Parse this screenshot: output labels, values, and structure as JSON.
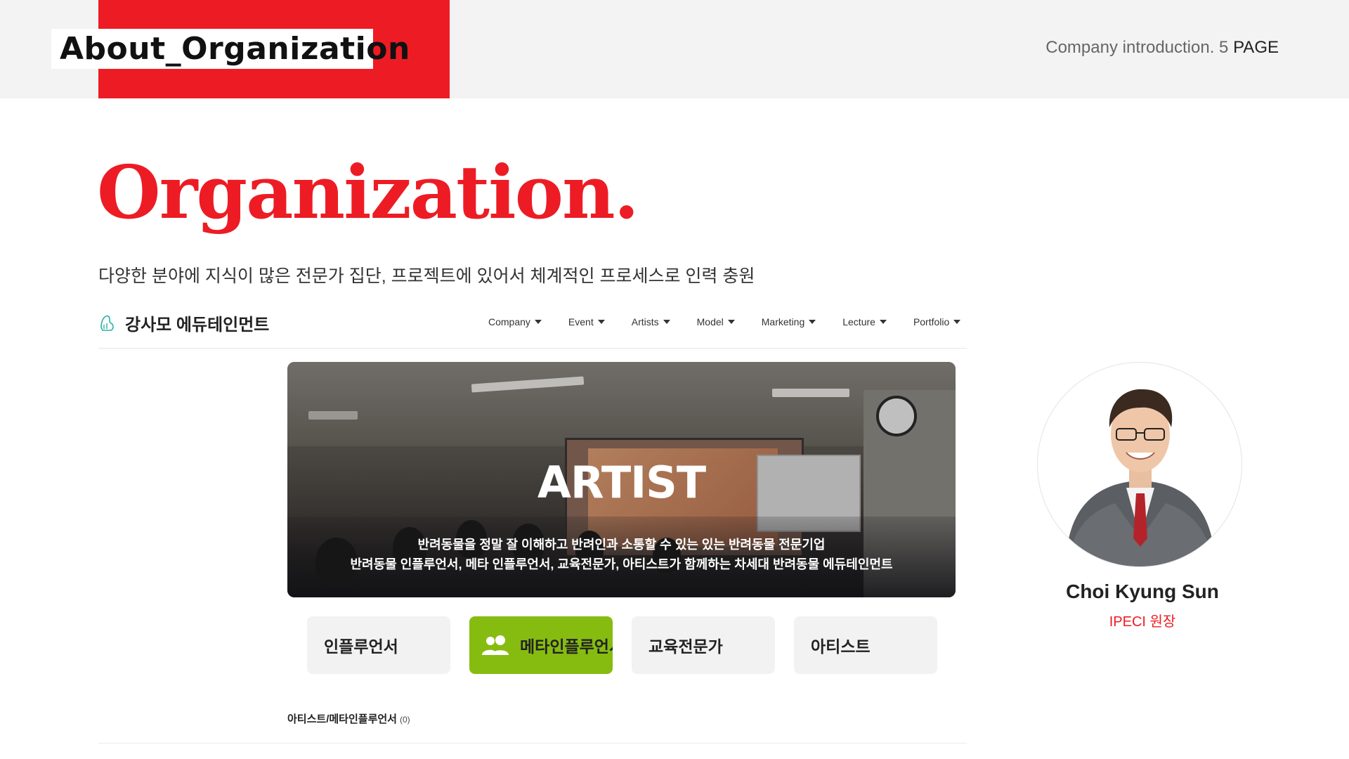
{
  "header": {
    "section_tag": "About_Organization",
    "page_info_text": "Company introduction.  5",
    "page_info_page": "PAGE"
  },
  "main": {
    "title": "Organization.",
    "subtitle": "다양한 분야에 지식이 많은 전문가 집단, 프로젝트에 있어서 체계적인 프로세스로 인력 충원"
  },
  "site": {
    "logo_text": "강사모 에듀테인먼트",
    "nav": [
      {
        "label": "Company"
      },
      {
        "label": "Event"
      },
      {
        "label": "Artists"
      },
      {
        "label": "Model"
      },
      {
        "label": "Marketing"
      },
      {
        "label": "Lecture"
      },
      {
        "label": "Portfolio"
      }
    ],
    "hero": {
      "title": "ARTIST",
      "line1": "반려동물을 정말 잘 이해하고 반려인과 소통할 수 있는 있는 반려동물 전문기업",
      "line2": "반려동물 인플루언서, 메타 인플루언서, 교육전문가, 아티스트가 함께하는 차세대 반려동물 에듀테인먼트"
    },
    "categories": [
      {
        "label": "인플루언서",
        "active": false
      },
      {
        "label": "메타인플루언서",
        "active": true,
        "icon": "people-icon"
      },
      {
        "label": "교육전문가",
        "active": false
      },
      {
        "label": "아티스트",
        "active": false
      }
    ],
    "list_label": "아티스트/메타인플루언서",
    "list_count": "(0)"
  },
  "profile": {
    "name": "Choi Kyung Sun",
    "role": "IPECI 원장"
  },
  "colors": {
    "accent_red": "#ed1c24",
    "active_green": "#86bc10",
    "top_band_gray": "#f3f3f3"
  }
}
